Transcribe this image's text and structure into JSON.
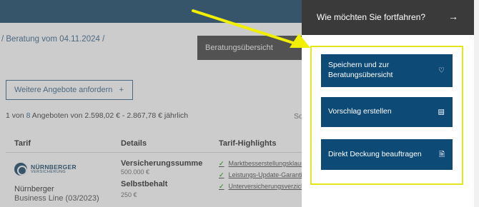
{
  "breadcrumb": {
    "text": "/ Beratung vom 04.11.2024 /"
  },
  "overview_button": {
    "label": "Beratungsübersicht"
  },
  "more_offers": {
    "label": "Weitere Angebote anfordern",
    "icon": "+"
  },
  "summary": {
    "prefix": "1 von ",
    "count": "8",
    "suffix": " Angeboten von 2.598,02 € - 2.867,78 € jährlich"
  },
  "sort_truncated": "So",
  "table": {
    "headers": {
      "tarif": "Tarif",
      "details": "Details",
      "highlights": "Tarif-Highlights"
    },
    "row": {
      "logo": {
        "name": "NÜRNBERGER",
        "sub": "VERSICHERUNG"
      },
      "tarif_name": "Nürnberger",
      "tarif_line": "Business Line (03/2023)",
      "details": [
        {
          "label": "Versicherungssumme",
          "value": "500.000 €"
        },
        {
          "label": "Selbstbehalt",
          "value": "250 €"
        }
      ],
      "highlights": [
        "Marktbesserstellungsklausel",
        "Leistungs-Update-Garantie",
        "Unterversicherungsverzicht"
      ]
    }
  },
  "panel": {
    "title": "Wie möchten Sie fortfahren?",
    "arrow": "→",
    "actions": [
      {
        "label": "Speichern und zur Beratungsübersicht",
        "icon": "heart-icon",
        "glyph": "♡"
      },
      {
        "label": "Vorschlag erstellen",
        "icon": "proposal-icon",
        "glyph": "▤"
      },
      {
        "label": "Direkt Deckung beauftragen",
        "icon": "document-icon",
        "glyph": "🗎"
      }
    ]
  },
  "colors": {
    "accent": "#0e4a76",
    "header": "#0e3f63",
    "panel_header": "#3a3a3a",
    "highlight": "#e6e61e"
  }
}
